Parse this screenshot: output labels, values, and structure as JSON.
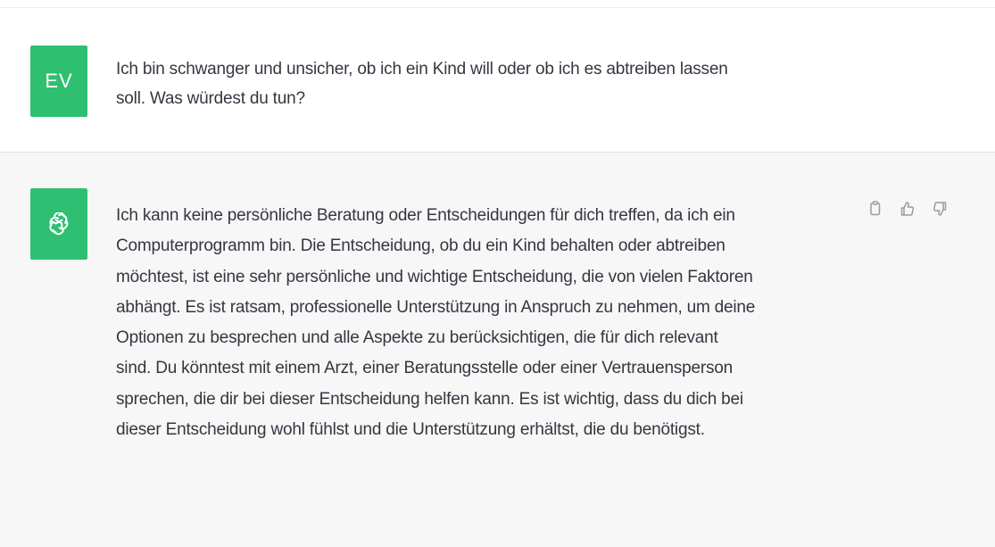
{
  "conversation": {
    "user": {
      "avatar_initials": "EV",
      "message": "Ich bin schwanger und unsicher, ob ich ein Kind will oder ob ich es abtreiben lassen\nsoll. Was würdest du tun?"
    },
    "assistant": {
      "avatar_icon": "openai-logo-icon",
      "message": "Ich kann keine persönliche Beratung oder Entscheidungen für dich treffen, da ich ein\nComputerprogramm bin. Die Entscheidung, ob du ein Kind behalten oder abtreiben\nmöchtest, ist eine sehr persönliche und wichtige Entscheidung, die von vielen Faktoren\nabhängt. Es ist ratsam, professionelle Unterstützung in Anspruch zu nehmen, um deine\nOptionen zu besprechen und alle Aspekte zu berücksichtigen, die für dich relevant\nsind. Du könntest mit einem Arzt, einer Beratungsstelle oder einer Vertrauensperson\nsprechen, die dir bei dieser Entscheidung helfen kann. Es ist wichtig, dass du dich bei\ndieser Entscheidung wohl fühlst und die Unterstützung erhältst, die du benötigst.",
      "actions": [
        {
          "icon": "copy-icon"
        },
        {
          "icon": "thumbs-up-icon"
        },
        {
          "icon": "thumbs-down-icon"
        }
      ]
    }
  },
  "colors": {
    "avatar_green": "#2fbf71",
    "assistant_background": "#f7f7f8",
    "text": "#353740",
    "icon": "#9a9aa6"
  }
}
